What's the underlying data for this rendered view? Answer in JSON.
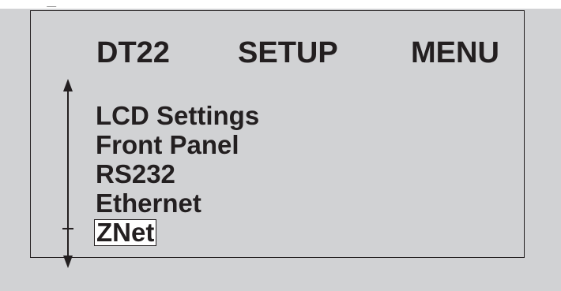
{
  "screen": {
    "title": {
      "left": "DT22",
      "center": "SETUP",
      "right": "MENU"
    },
    "menu": {
      "items": [
        {
          "label": "LCD Settings",
          "selected": false
        },
        {
          "label": "Front Panel",
          "selected": false
        },
        {
          "label": "RS232",
          "selected": false
        },
        {
          "label": "Ethernet",
          "selected": false
        },
        {
          "label": "ZNet",
          "selected": true
        }
      ]
    },
    "scroll_indicator": {
      "icon_up": "arrow-up-icon",
      "icon_down": "arrow-down-icon",
      "position_fraction": 0.83
    }
  },
  "colors": {
    "screen_bg": "#d1d2d4",
    "text": "#231f20",
    "selection_bg": "#ffffff"
  }
}
